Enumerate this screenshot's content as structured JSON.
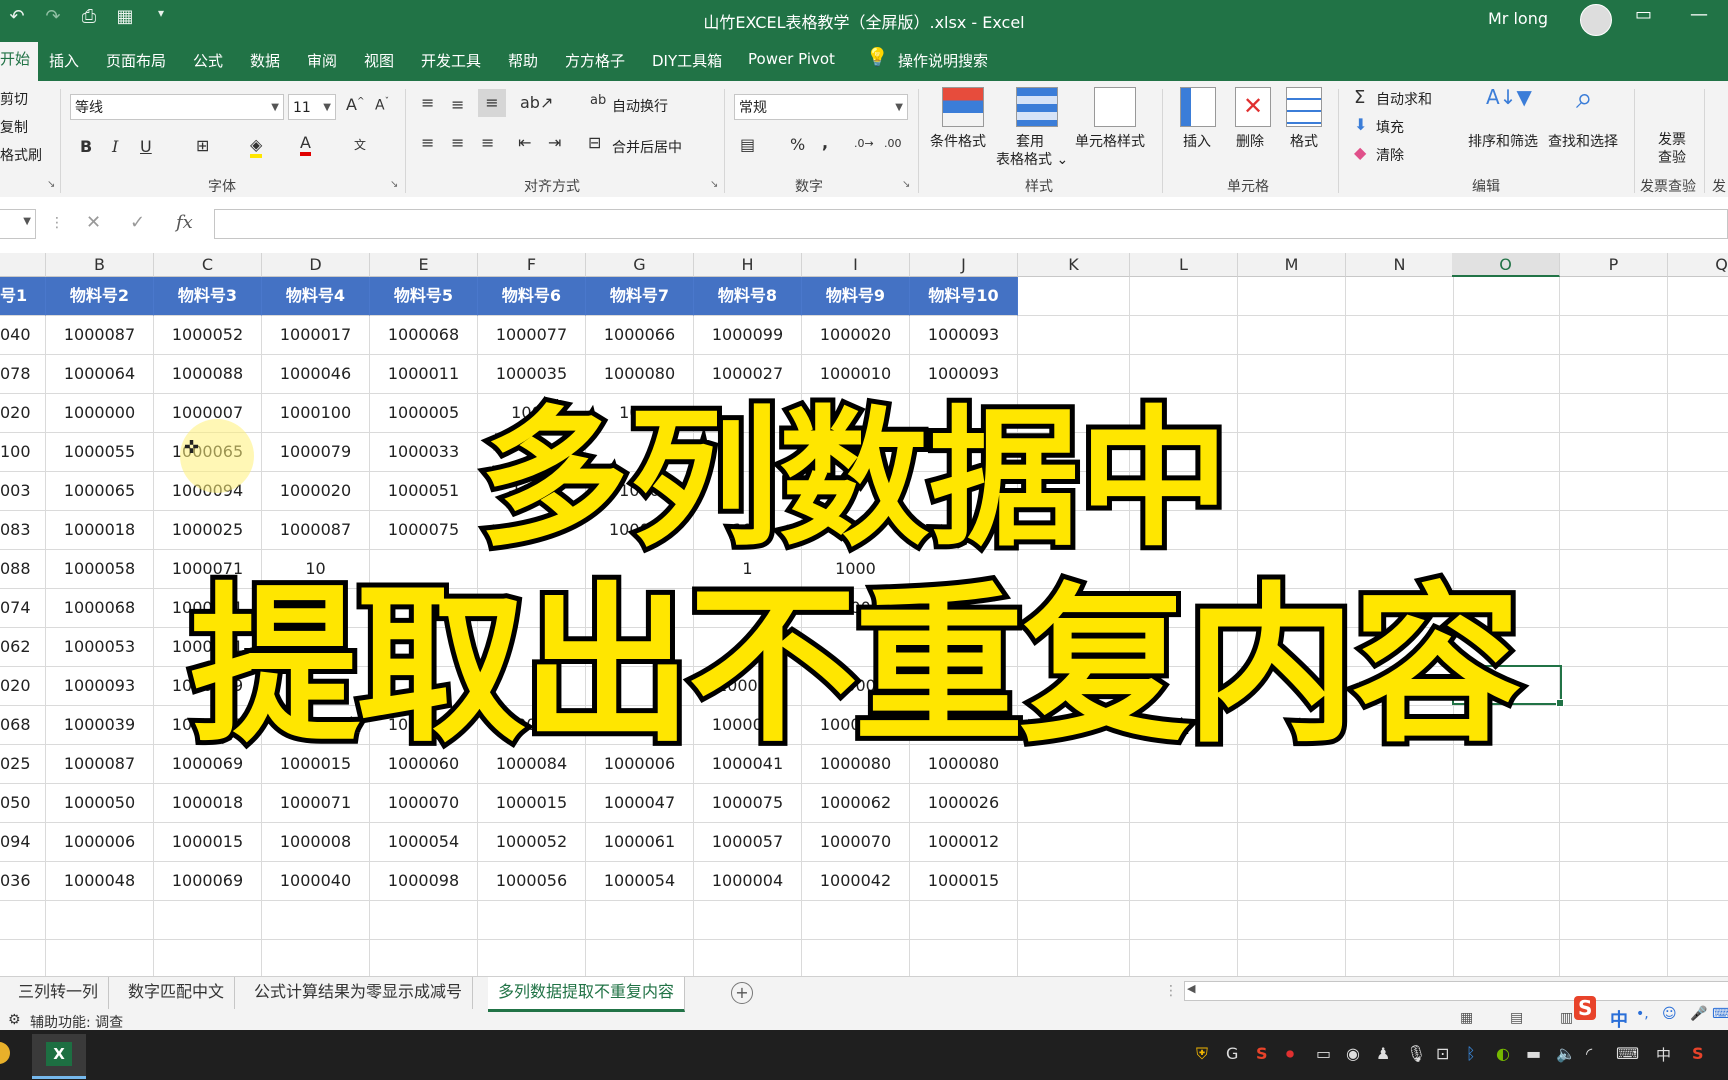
{
  "window": {
    "title": "山竹EXCEL表格教学（全屏版）.xlsx  -  Excel",
    "user": "Mr long"
  },
  "ribbon_tabs": [
    "开始",
    "插入",
    "页面布局",
    "公式",
    "数据",
    "审阅",
    "视图",
    "开发工具",
    "帮助",
    "方方格子",
    "DIY工具箱",
    "Power Pivot"
  ],
  "tell_me": "操作说明搜索",
  "ribbon": {
    "clipboard": {
      "cut": "剪切",
      "copy": "复制",
      "format_painter": "格式刷"
    },
    "font": {
      "name": "等线",
      "size": "11",
      "group_label": "字体"
    },
    "alignment": {
      "wrap": "自动换行",
      "merge": "合并后居中",
      "group_label": "对齐方式"
    },
    "number": {
      "format": "常规",
      "group_label": "数字"
    },
    "styles": {
      "conditional": "条件格式",
      "table_format": "套用\n表格格式",
      "cell_styles": "单元格样式",
      "group_label": "样式"
    },
    "cells": {
      "insert": "插入",
      "delete": "删除",
      "format": "格式",
      "group_label": "单元格"
    },
    "editing": {
      "autosum": "自动求和",
      "fill": "填充",
      "clear": "清除",
      "sort_filter": "排序和筛选",
      "find_select": "查找和选择",
      "group_label": "编辑"
    },
    "invoice": {
      "check": "发票\n查验",
      "group_label": "发票查验",
      "cut_label": "发"
    }
  },
  "columns": [
    "B",
    "C",
    "D",
    "E",
    "F",
    "G",
    "H",
    "I",
    "J",
    "K",
    "L",
    "M",
    "N",
    "O",
    "P",
    "Q"
  ],
  "selected_column": "O",
  "headers": [
    "号1",
    "物料号2",
    "物料号3",
    "物料号4",
    "物料号5",
    "物料号6",
    "物料号7",
    "物料号8",
    "物料号9",
    "物料号10"
  ],
  "rows": [
    [
      "040",
      "1000087",
      "1000052",
      "1000017",
      "1000068",
      "1000077",
      "1000066",
      "1000099",
      "1000020",
      "1000093"
    ],
    [
      "078",
      "1000064",
      "1000088",
      "1000046",
      "1000011",
      "1000035",
      "1000080",
      "1000027",
      "1000010",
      "1000093"
    ],
    [
      "020",
      "1000000",
      "1000007",
      "1000100",
      "1000005",
      "1000",
      "1000",
      "",
      "",
      ""
    ],
    [
      "100",
      "1000055",
      "1000065",
      "1000079",
      "1000033",
      "1",
      "",
      "",
      "",
      ""
    ],
    [
      "003",
      "1000065",
      "1000094",
      "1000020",
      "1000051",
      "1000",
      "1000",
      "",
      "",
      ""
    ],
    [
      "083",
      "1000018",
      "1000025",
      "1000087",
      "1000075",
      "1000",
      "100008",
      "100",
      "10000",
      ""
    ],
    [
      "088",
      "1000058",
      "1000071",
      "10",
      "",
      "",
      "",
      "1",
      "1000",
      ""
    ],
    [
      "074",
      "1000068",
      "1000031",
      "10",
      "",
      "",
      "",
      "100",
      "10004",
      ""
    ],
    [
      "062",
      "1000053",
      "1000061",
      "10",
      "",
      "",
      "",
      "",
      "",
      ""
    ],
    [
      "020",
      "1000093",
      "1000039",
      "10",
      "",
      "",
      "",
      "100008",
      "1000",
      ""
    ],
    [
      "068",
      "1000039",
      "1000059",
      "1000036",
      "1000084",
      "1000094",
      "1000033",
      "1000056",
      "1000029",
      "1000095"
    ],
    [
      "025",
      "1000087",
      "1000069",
      "1000015",
      "1000060",
      "1000084",
      "1000006",
      "1000041",
      "1000080",
      "1000080"
    ],
    [
      "050",
      "1000050",
      "1000018",
      "1000071",
      "1000070",
      "1000015",
      "1000047",
      "1000075",
      "1000062",
      "1000026"
    ],
    [
      "094",
      "1000006",
      "1000015",
      "1000008",
      "1000054",
      "1000052",
      "1000061",
      "1000057",
      "1000070",
      "1000012"
    ],
    [
      "036",
      "1000048",
      "1000069",
      "1000040",
      "1000098",
      "1000056",
      "1000054",
      "1000004",
      "1000042",
      "1000015"
    ]
  ],
  "overlay": {
    "line1": "多列数据中",
    "line2": "提取出不重复内容"
  },
  "sheet_tabs": [
    "三列转一列",
    "数字匹配中文",
    "公式计算结果为零显示成减号",
    "多列数据提取不重复内容"
  ],
  "active_sheet": "多列数据提取不重复内容",
  "status": {
    "accessibility": "辅助功能: 调查"
  },
  "taskbar": {
    "ime": "中"
  },
  "colors": {
    "excel_green": "#217346",
    "header_fill": "#4472c4",
    "overlay_fill": "#ffe600"
  }
}
